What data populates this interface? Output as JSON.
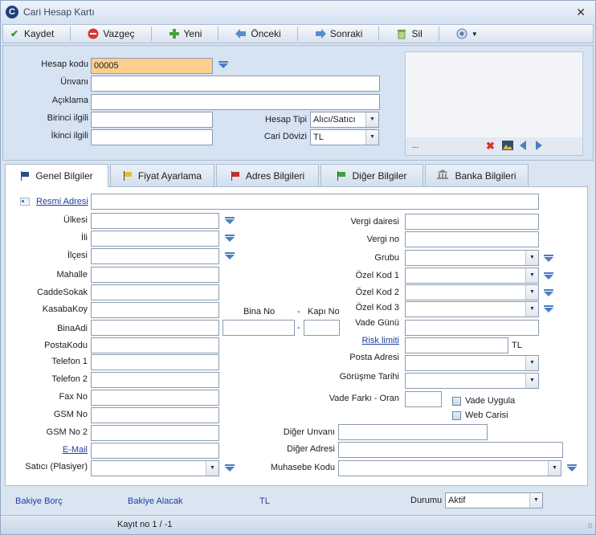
{
  "window": {
    "title": "Cari Hesap Kartı",
    "close_glyph": "✕"
  },
  "toolbar": {
    "save": "Kaydet",
    "cancel": "Vazgeç",
    "new": "Yeni",
    "prev": "Önceki",
    "next": "Sonraki",
    "delete": "Sil"
  },
  "header": {
    "hesap_kodu_label": "Hesap kodu",
    "hesap_kodu_value": "00005",
    "unvani_label": "Ünvanı",
    "aciklama_label": "Açıklama",
    "birinci_ilgili_label": "Birinci ilgili",
    "ikinci_ilgili_label": "İkinci ilgili",
    "hesap_tipi_label": "Hesap Tipi",
    "hesap_tipi_value": "Alıcı/Satıcı",
    "cari_dovizi_label": "Cari Dövizi",
    "cari_dovizi_value": "TL",
    "image_dots": "..."
  },
  "tabs": [
    "Genel Bilgiler",
    "Fiyat Ayarlama",
    "Adres Bilgileri",
    "Diğer Bilgiler",
    "Banka Bilgileri"
  ],
  "form": {
    "resmi_adresi": "Resmi Adresi",
    "ulkesi": "Ülkesi",
    "ili": "İli",
    "ilcesi": "İlçesi",
    "mahalle": "Mahalle",
    "caddesokak": "CaddeSokak",
    "kasabakoy": "KasabaKoy",
    "binaadi": "BinaAdi",
    "postakodu": "PostaKodu",
    "telefon1": "Telefon 1",
    "telefon2": "Telefon 2",
    "fax": "Fax No",
    "gsm": "GSM No",
    "gsm2": "GSM No 2",
    "email": "E-Mail",
    "satici": "Satıcı (Plasiyer)",
    "bina_no": "Bina No",
    "kapi_no": "Kapı No",
    "dash": "-",
    "vergi_dairesi": "Vergi dairesi",
    "vergi_no": "Vergi no",
    "grubu": "Grubu",
    "ozel_kod1": "Özel Kod 1",
    "ozel_kod2": "Özel Kod 2",
    "ozel_kod3": "Özel Kod 3",
    "vade_gunu": "Vade Günü",
    "risk_limiti": "Risk limiti",
    "risk_currency": "TL",
    "posta_adresi": "Posta Adresi",
    "gorusme_tarihi": "Görüşme Tarihi",
    "vade_farki": "Vade Farkı - Oran",
    "vade_uygula": "Vade Uygula",
    "web_carisi": "Web Carisi",
    "diger_unvani": "Diğer Unvanı",
    "diger_adresi": "Diğer Adresi",
    "muhasebe_kodu": "Muhasebe Kodu"
  },
  "bottom": {
    "bakiye_borc": "Bakiye Borç",
    "bakiye_alacak": "Bakiye Alacak",
    "currency": "TL",
    "durumu_label": "Durumu",
    "durumu_value": "Aktif"
  },
  "status": {
    "record": "Kayıt no 1 / -1"
  },
  "colors": {
    "accent": "#4a7ec4",
    "highlight_input": "#fdcf8e"
  }
}
